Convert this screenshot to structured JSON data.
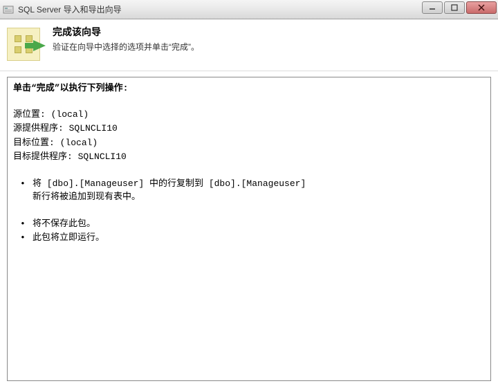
{
  "titlebar": {
    "title": "SQL Server 导入和导出向导"
  },
  "header": {
    "title": "完成该向导",
    "subtitle": "验证在向导中选择的选项并单击“完成”。"
  },
  "content": {
    "heading": "单击“完成”以执行下列操作:",
    "source_location_label": "源位置:",
    "source_location_value": "(local)",
    "source_provider_label": "源提供程序:",
    "source_provider_value": "SQLNCLI10",
    "dest_location_label": "目标位置:",
    "dest_location_value": "(local)",
    "dest_provider_label": "目标提供程序:",
    "dest_provider_value": "SQLNCLI10",
    "action_copy": "将 [dbo].[Manageuser] 中的行复制到 [dbo].[Manageuser]",
    "action_copy_sub": "新行将被追加到现有表中。",
    "action_no_save": "将不保存此包。",
    "action_run_now": "此包将立即运行。"
  }
}
